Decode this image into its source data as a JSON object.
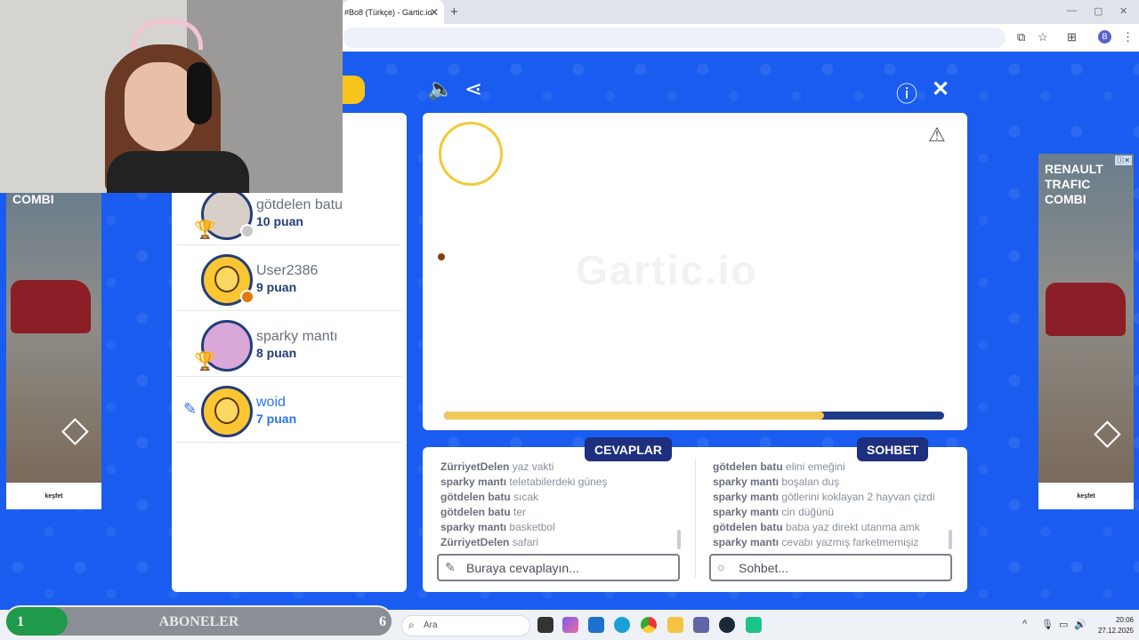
{
  "browser": {
    "tab_title": "#Bo8 (Türkçe) - Gartic.io",
    "tab_close": "✕",
    "new_tab": "+",
    "profile_initial": "B"
  },
  "ads": {
    "left_title": "COMBI",
    "right_title": "RENAULT TRAFIC COMBI",
    "cta": "keşfet"
  },
  "players": [
    {
      "name": "götdelen batu",
      "score": "10 puan",
      "trophy": true,
      "badge_color": "#c8c8c8",
      "active": false
    },
    {
      "name": "User2386",
      "score": "9 puan",
      "trophy": false,
      "badge_color": "#e07a10",
      "active": false
    },
    {
      "name": "sparky mantı",
      "score": "8 puan",
      "trophy": true,
      "badge_color": null,
      "active": false
    },
    {
      "name": "woid",
      "score": "7 puan",
      "trophy": false,
      "badge_color": null,
      "active": true
    }
  ],
  "canvas": {
    "progress": 0.76
  },
  "answers": {
    "label": "CEVAPLAR",
    "placeholder": "Buraya cevaplayın...",
    "messages": [
      {
        "who": "ZürriyetDelen",
        "text": "yaz vakti"
      },
      {
        "who": "sparky mantı",
        "text": "teletabilerdeki güneş"
      },
      {
        "who": "götdelen batu",
        "text": "sıcak"
      },
      {
        "who": "götdelen batu",
        "text": "ter"
      },
      {
        "who": "sparky mantı",
        "text": "basketbol"
      },
      {
        "who": "ZürriyetDelen",
        "text": "safari"
      }
    ]
  },
  "chat": {
    "label": "SOHBET",
    "placeholder": "Sohbet...",
    "messages": [
      {
        "who": "götdelen batu",
        "text": "elini emeğini"
      },
      {
        "who": "sparky mantı",
        "text": "boşalan duş"
      },
      {
        "who": "sparky mantı",
        "text": "götlerini koklayan 2 hayvan çizdi"
      },
      {
        "who": "sparky mantı",
        "text": "cin düğünü"
      },
      {
        "who": "götdelen batu",
        "text": "baba yaz direkt utanma amk"
      },
      {
        "who": "sparky mantı",
        "text": "cevabı yazmış farketmemişiz"
      }
    ]
  },
  "overlay": {
    "left_value": "1",
    "label": "ABONELER",
    "right_value": "6",
    "progress": 0.16
  },
  "taskbar": {
    "search_placeholder": "Ara",
    "time": "20:06",
    "date": "27.12.2025"
  }
}
